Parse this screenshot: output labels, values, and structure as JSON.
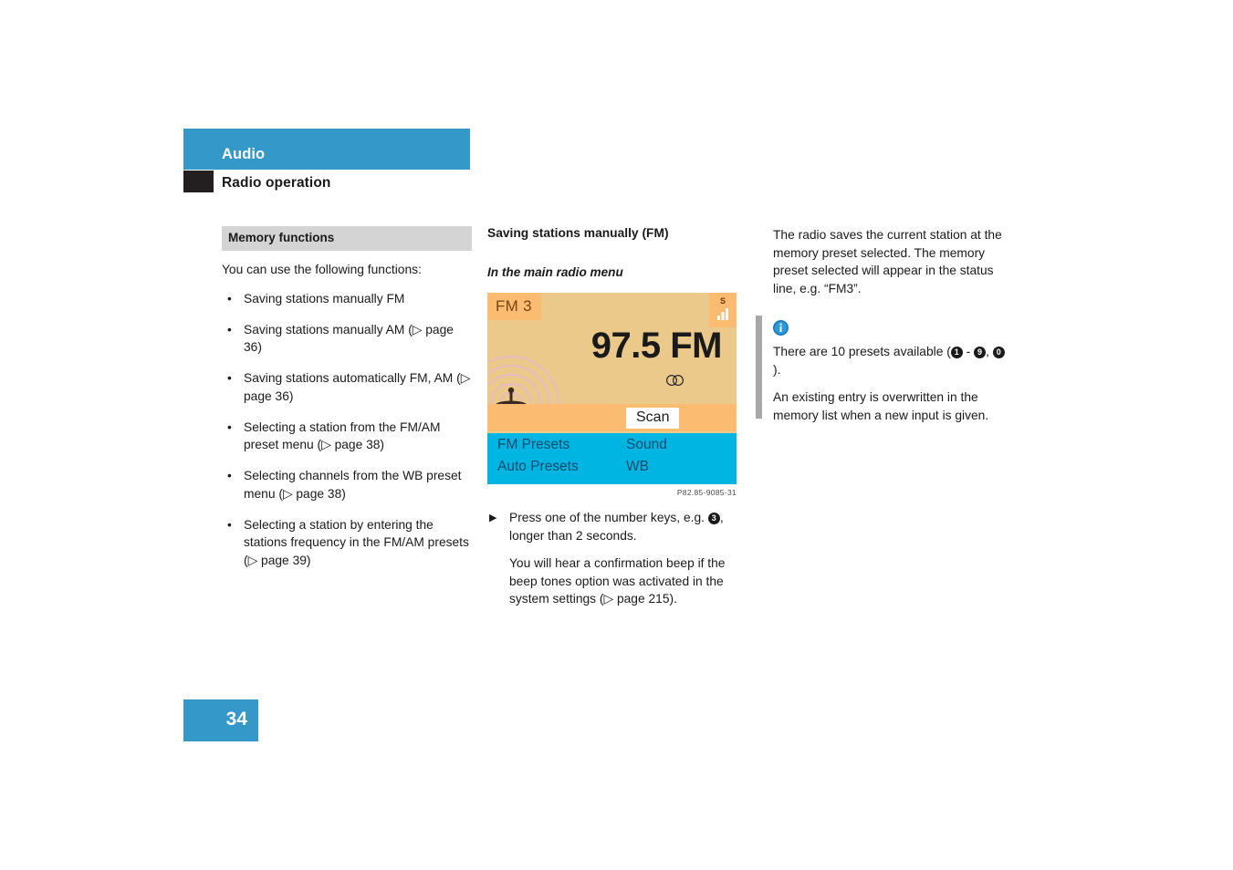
{
  "header": {
    "title": "Audio",
    "subtitle": "Radio operation",
    "accent_color": "#3498c8",
    "square_color": "#231f20"
  },
  "left_column": {
    "section_title": "Memory functions",
    "intro": "You can use the following functions:",
    "bullets": [
      "Saving stations manually FM",
      "Saving stations manually AM (▷ page 36)",
      "Saving stations automatically FM, AM (▷ page 36)",
      "Selecting a station from the FM/AM preset menu (▷ page 38)",
      "Selecting channels from the WB preset menu (▷ page 38)",
      "Selecting a station by entering the stations frequency in the FM/AM presets (▷ page 39)"
    ],
    "bullet_marker": "•"
  },
  "middle_column": {
    "heading": "Saving stations manually (FM)",
    "subheading": "In the main radio menu",
    "radio_display": {
      "preset_badge": "FM 3",
      "frequency": "97.5 FM",
      "signal_indicator": "signal-strength-icon",
      "stereo_indicator": "stereo-icon",
      "antenna_indicator": "broadcast-tower-icon",
      "scan_button": "Scan",
      "menu_items": [
        "FM Presets",
        "Sound",
        "Auto Presets",
        "WB"
      ],
      "background_color": "#ebc98a",
      "badge_color": "#fbbc72",
      "menu_color": "#00b5e2",
      "menu_text_color": "#134a6e"
    },
    "image_caption": "P82.85-9085-31",
    "instruction_arrow": "▶",
    "instruction_pre": "Press one of the number keys, e.g. ",
    "instruction_key": "3",
    "instruction_post": ", longer than 2 seconds.",
    "note": "You will hear a confirmation beep if the beep tones option was activated in the system settings (▷ page 215)."
  },
  "right_column": {
    "paragraph_1": "The radio saves the current station at the memory preset selected. The memory preset selected will appear in the status line, e.g. “FM3”.",
    "info_icon": "info-icon",
    "info_pre": "There are 10 presets available (",
    "info_key_first": "1",
    "info_key_sep": " - ",
    "info_key_second": "9",
    "info_key_comma": ", ",
    "info_key_third": "0",
    "info_post": ").",
    "info_paragraph_2": "An existing entry is overwritten in the memory list when a new input is given."
  },
  "footer": {
    "page_number": "34",
    "box_color": "#3498c8"
  }
}
